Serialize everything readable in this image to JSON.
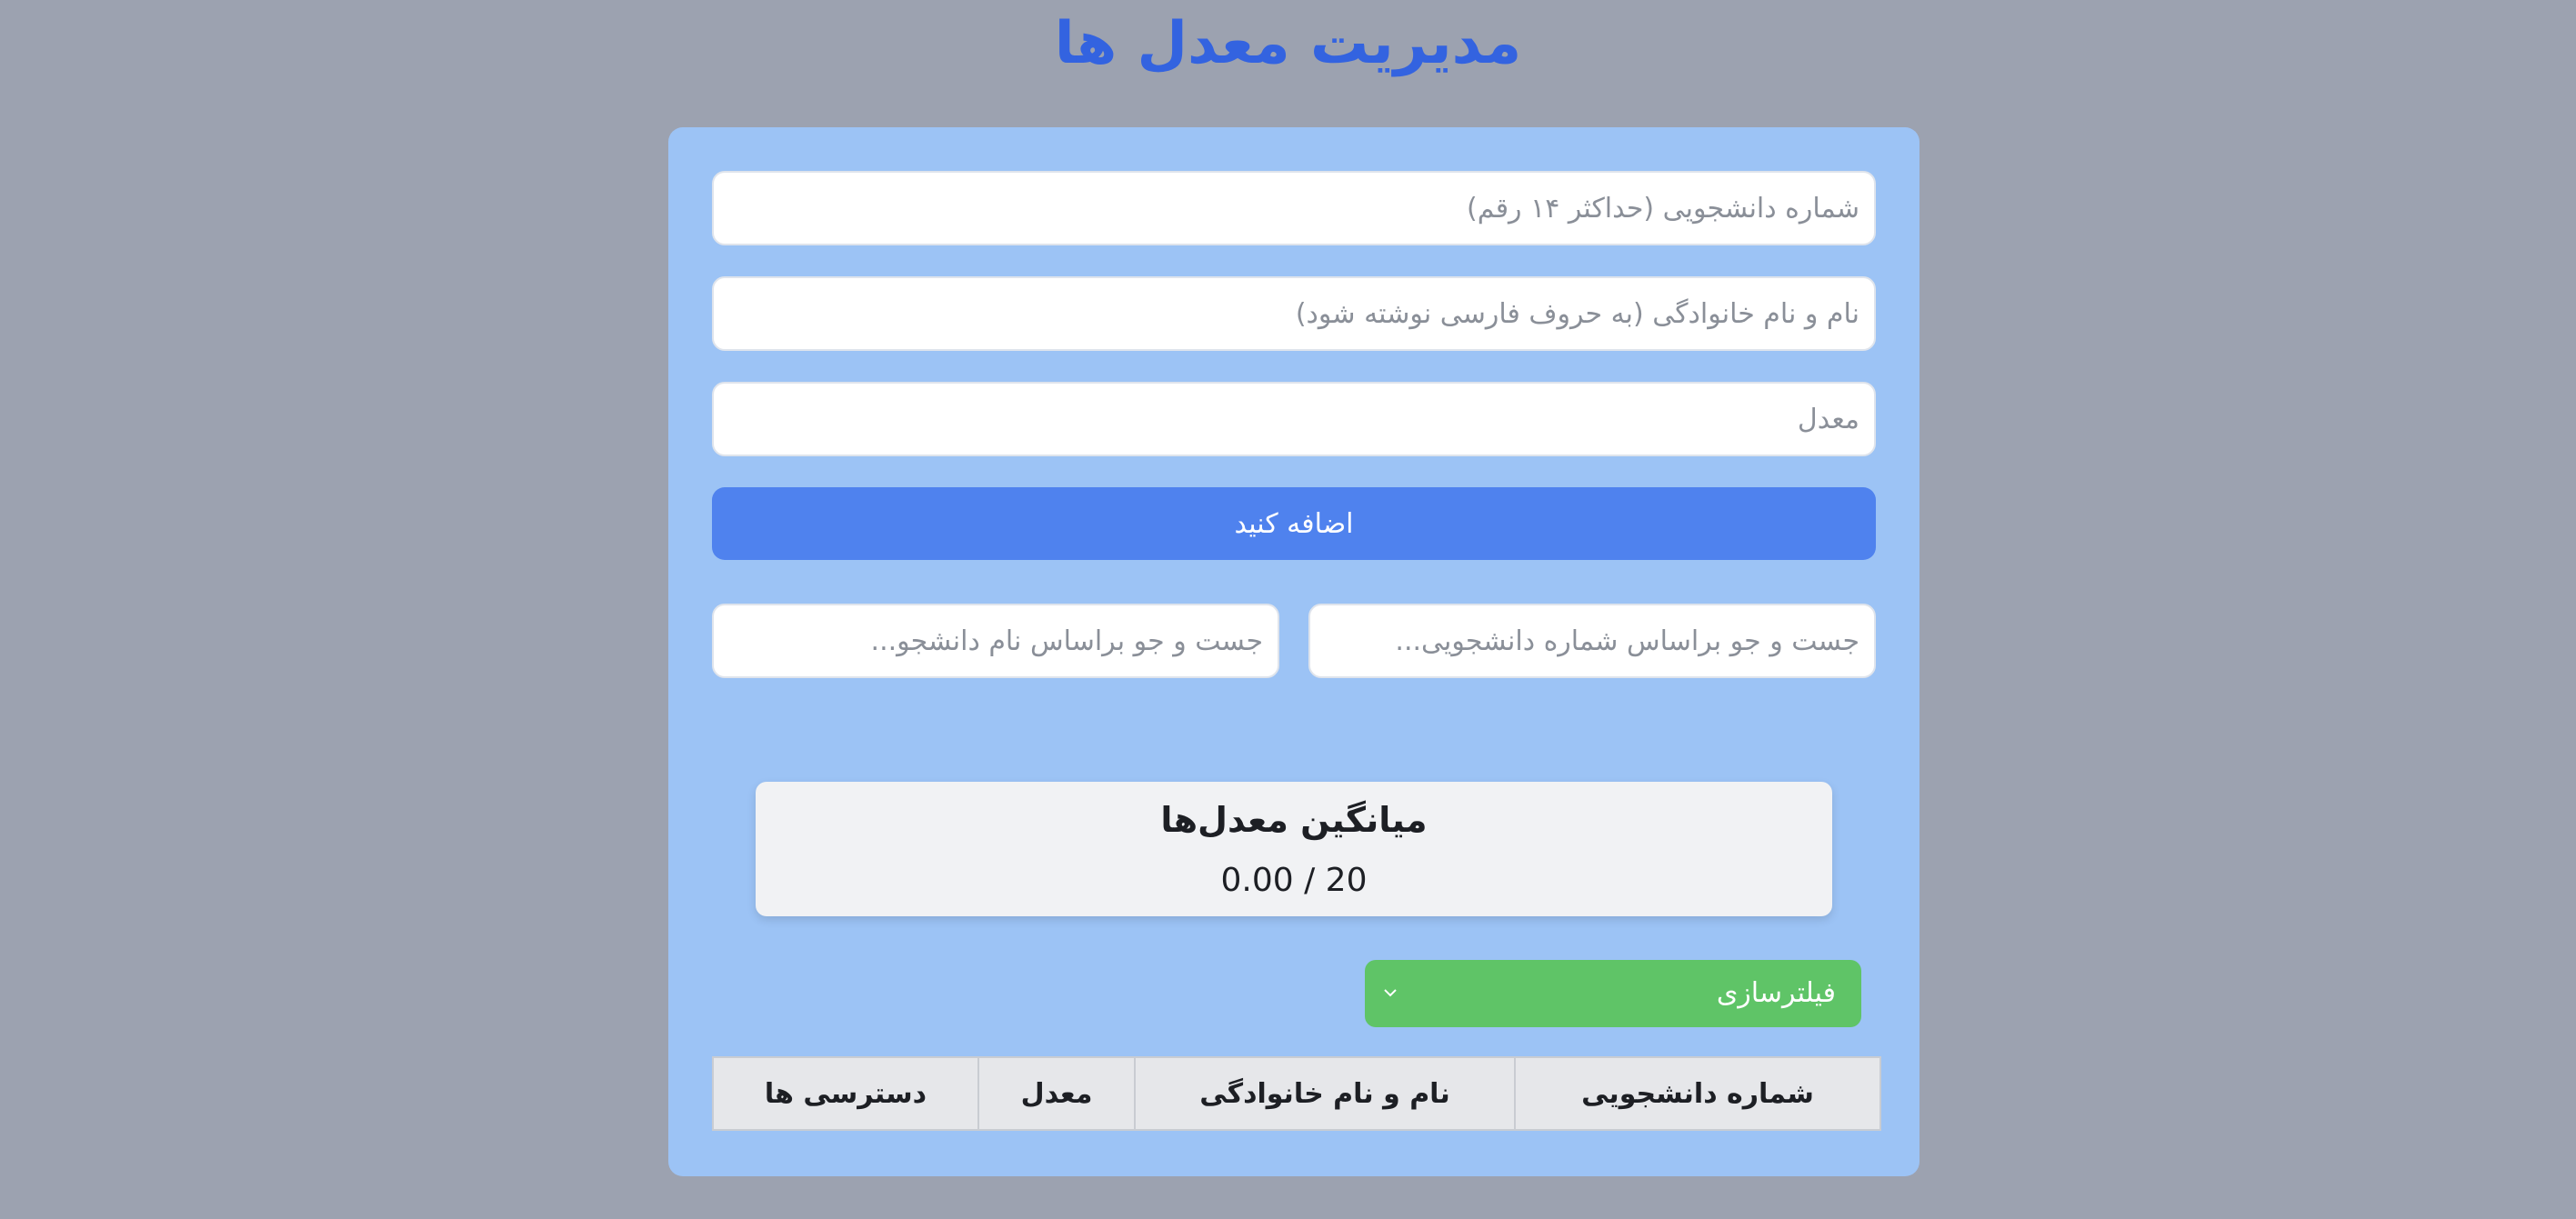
{
  "header": {
    "title": "مدیریت معدل ها"
  },
  "form": {
    "student_id_placeholder": "شماره دانشجویی (حداکثر ۱۴ رقم)",
    "name_placeholder": "نام و نام خانوادگی (به حروف فارسی نوشته شود)",
    "gpa_placeholder": "معدل",
    "add_label": "اضافه کنید"
  },
  "search": {
    "by_student_id_placeholder": "جست و جو براساس شماره دانشجویی...",
    "by_name_placeholder": "جست و جو براساس نام دانشجو..."
  },
  "average": {
    "title": "میانگین معدل‌ها",
    "value": "0.00 / 20"
  },
  "filter": {
    "label": "فیلترسازی"
  },
  "table": {
    "headers": [
      "شماره دانشجویی",
      "نام و نام خانوادگی",
      "معدل",
      "دسترسی ها"
    ]
  },
  "colors": {
    "background": "#9ca2b0",
    "card": "#9cc3f5",
    "title": "#3363e0",
    "add_button": "#4f82ee",
    "filter_button": "#5fc467"
  }
}
